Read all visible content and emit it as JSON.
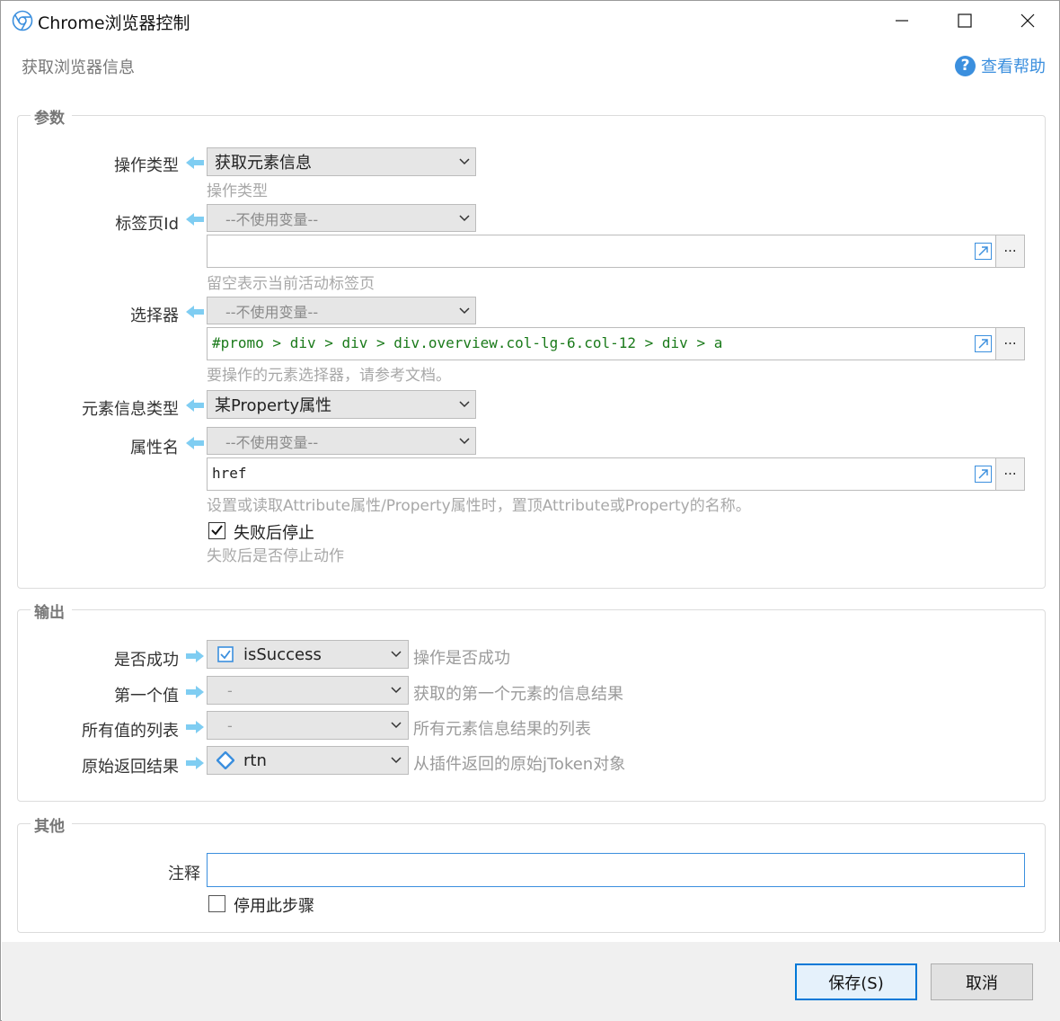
{
  "window": {
    "title": "Chrome浏览器控制",
    "subtitle": "获取浏览器信息",
    "help_label": "查看帮助"
  },
  "params": {
    "title": "参数",
    "op_type": {
      "label": "操作类型",
      "value": "获取元素信息",
      "hint": "操作类型"
    },
    "tab_id": {
      "label": "标签页Id",
      "var_value": "--不使用变量--",
      "text": "",
      "hint": "留空表示当前活动标签页"
    },
    "selector": {
      "label": "选择器",
      "var_value": "--不使用变量--",
      "text": "#promo > div > div > div.overview.col-lg-6.col-12 > div > a",
      "hint": "要操作的元素选择器，请参考文档。"
    },
    "info_type": {
      "label": "元素信息类型",
      "value": "某Property属性"
    },
    "attr_name": {
      "label": "属性名",
      "var_value": "--不使用变量--",
      "text": "href",
      "hint": "设置或读取Attribute属性/Property属性时，置顶Attribute或Property的名称。"
    },
    "stop_on_fail": {
      "label": "失败后停止",
      "checked": true,
      "hint": "失败后是否停止动作"
    },
    "more_label": "..."
  },
  "output": {
    "title": "输出",
    "rows": [
      {
        "label": "是否成功",
        "value": "isSuccess",
        "icon": "checkbox-icon",
        "hint": "操作是否成功"
      },
      {
        "label": "第一个值",
        "value": "-",
        "icon": "",
        "hint": "获取的第一个元素的信息结果"
      },
      {
        "label": "所有值的列表",
        "value": "-",
        "icon": "",
        "hint": "所有元素信息结果的列表"
      },
      {
        "label": "原始返回结果",
        "value": "rtn",
        "icon": "diamond-icon",
        "hint": "从插件返回的原始jToken对象"
      }
    ]
  },
  "other": {
    "title": "其他",
    "note_label": "注释",
    "note_value": "",
    "disable_label": "停用此步骤",
    "disable_checked": false
  },
  "buttons": {
    "save": "保存(S)",
    "cancel": "取消"
  },
  "colors": {
    "accent": "#3b8fde",
    "arrow": "#7fcdf2",
    "selector_text": "#1a7a1a"
  }
}
